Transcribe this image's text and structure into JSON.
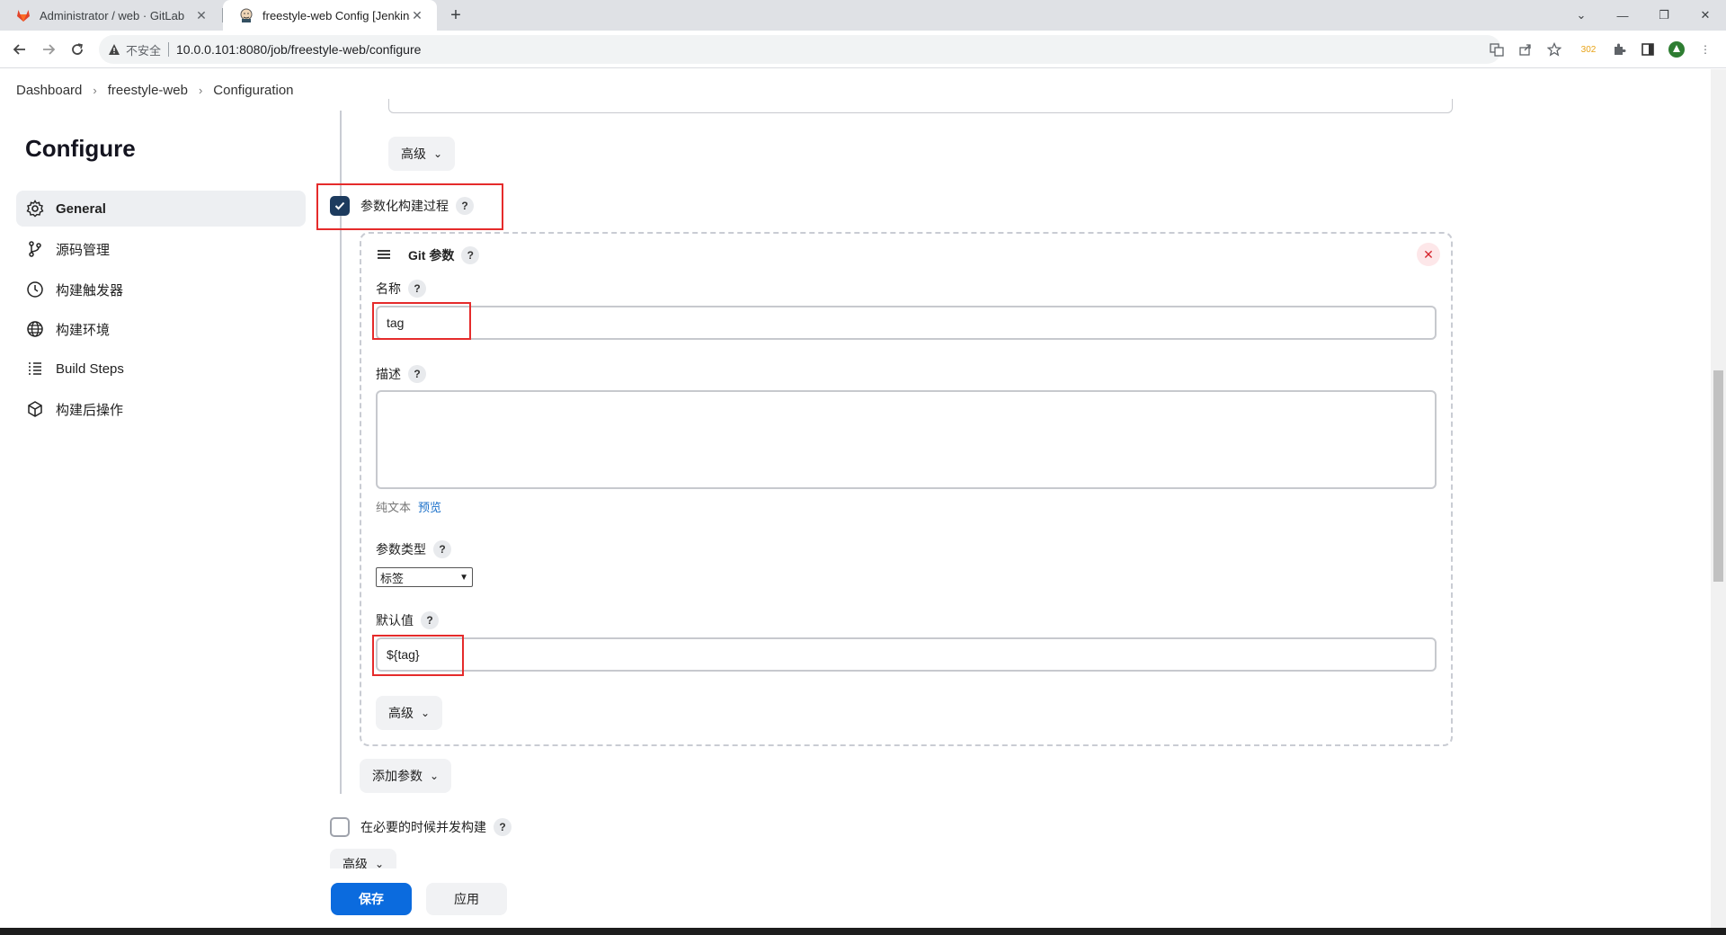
{
  "browser": {
    "tabs": [
      {
        "title": "Administrator / web · GitLab",
        "icon": "gitlab-icon",
        "active": false
      },
      {
        "title": "freestyle-web Config [Jenkins]",
        "icon": "jenkins-icon",
        "active": true
      }
    ],
    "security_label": "不安全",
    "url": "10.0.0.101:8080/job/freestyle-web/configure",
    "extension_badge": "302"
  },
  "breadcrumb": [
    "Dashboard",
    "freestyle-web",
    "Configuration"
  ],
  "sidebar": {
    "title": "Configure",
    "items": [
      {
        "label": "General",
        "icon": "gear-icon",
        "active": true
      },
      {
        "label": "源码管理",
        "icon": "branch-icon"
      },
      {
        "label": "构建触发器",
        "icon": "clock-icon"
      },
      {
        "label": "构建环境",
        "icon": "globe-icon"
      },
      {
        "label": "Build Steps",
        "icon": "list-icon"
      },
      {
        "label": "构建后操作",
        "icon": "cube-icon"
      }
    ]
  },
  "main": {
    "advanced_label": "高级",
    "parameterized_label": "参数化构建过程",
    "parameterized_checked": true,
    "git_param": {
      "header": "Git 参数",
      "name_label": "名称",
      "name_value": "tag",
      "desc_label": "描述",
      "desc_value": "",
      "plain_text": "纯文本",
      "preview": "预览",
      "type_label": "参数类型",
      "type_value": "标签",
      "default_label": "默认值",
      "default_value": "${tag}",
      "advanced_label": "高级"
    },
    "add_param_label": "添加参数",
    "concurrent_label": "在必要的时候并发构建",
    "concurrent_checked": false,
    "advanced2_label": "高级",
    "help_glyph": "?"
  },
  "footer": {
    "save_label": "保存",
    "apply_label": "应用"
  },
  "colors": {
    "accent": "#0b6bde",
    "checkbox_checked": "#1d3b5e",
    "highlight_box": "#e52b2b",
    "preview_link": "#1a6fc9"
  }
}
